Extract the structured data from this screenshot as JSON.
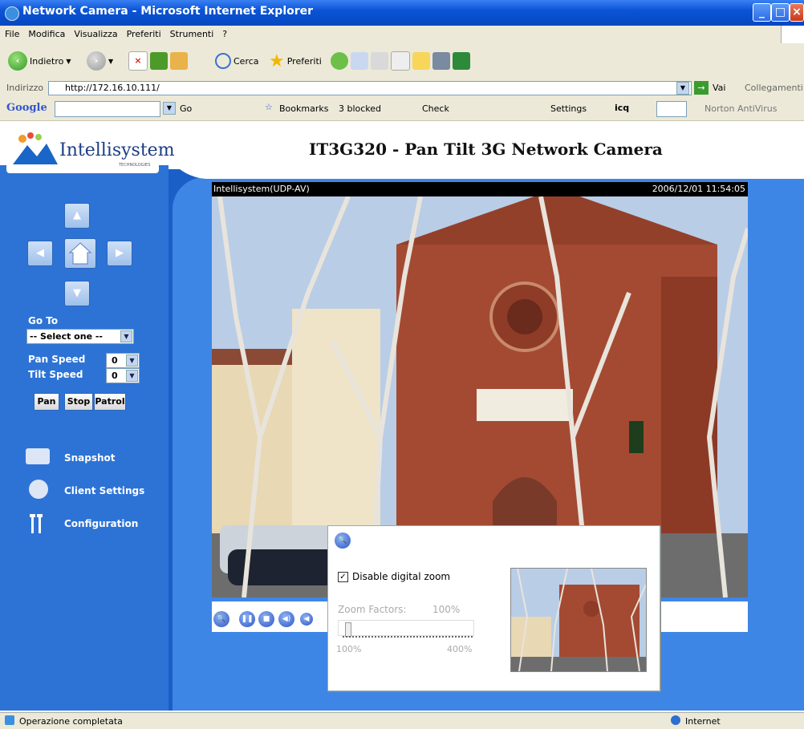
{
  "window": {
    "title": "Network Camera - Microsoft Internet Explorer"
  },
  "menu": {
    "items": [
      "File",
      "Modifica",
      "Visualizza",
      "Preferiti",
      "Strumenti",
      "?"
    ]
  },
  "toolbar": {
    "back_label": "Indietro",
    "search_label": "Cerca",
    "favorites_label": "Preferiti"
  },
  "address": {
    "label": "Indirizzo",
    "url": "http://172.16.10.111/",
    "go_label": "Vai",
    "links_label": "Collegamenti"
  },
  "googlebar": {
    "go_label": "Go",
    "bookmarks_label": "Bookmarks",
    "blocked_label": "3 blocked",
    "check_label": "Check",
    "settings_label": "Settings",
    "icq_label": "icq",
    "norton_label": "Norton AntiVirus"
  },
  "header": {
    "logo_text": "Intellisystem",
    "logo_sub": "TECHNOLOGIES",
    "title": "IT3G320 - Pan Tilt 3G Network Camera"
  },
  "sidebar": {
    "goto_label": "Go To",
    "goto_selected": "-- Select one --",
    "pan_speed_label": "Pan Speed",
    "pan_speed_value": "0",
    "tilt_speed_label": "Tilt Speed",
    "tilt_speed_value": "0",
    "pan_btn": "Pan",
    "stop_btn": "Stop",
    "patrol_btn": "Patrol",
    "snapshot": "Snapshot",
    "client_settings": "Client Settings",
    "configuration": "Configuration"
  },
  "video": {
    "source": "Intellisystem(UDP-AV)",
    "timestamp": "2006/12/01 11:54:05"
  },
  "zoom": {
    "checkbox_label": "Disable digital zoom",
    "checked": true,
    "factor_label": "Zoom Factors:",
    "factor_value": "100%",
    "min_label": "100%",
    "max_label": "400%"
  },
  "status": {
    "text": "Operazione completata",
    "zone": "Internet"
  }
}
